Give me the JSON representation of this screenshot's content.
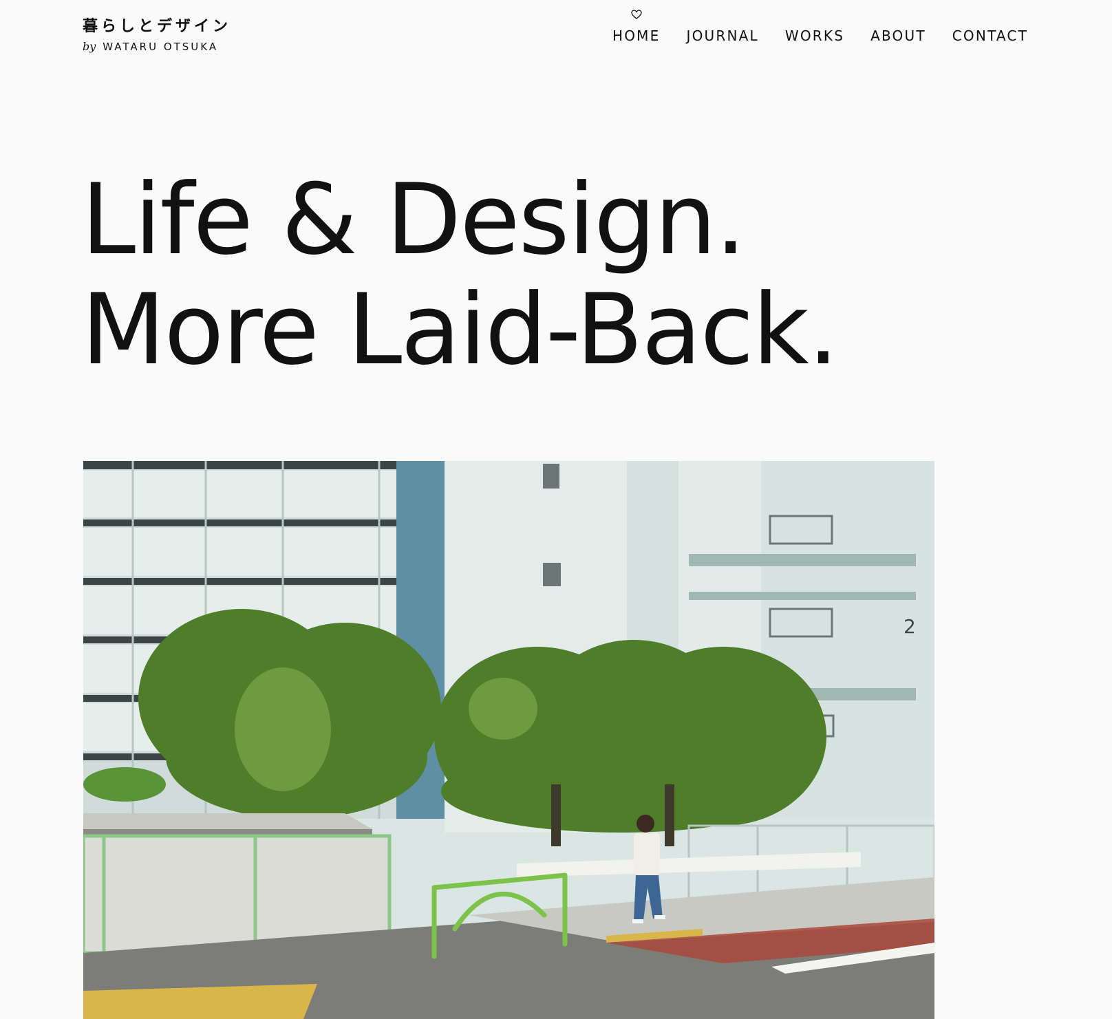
{
  "header": {
    "logo_title": "暮らしとデザイン",
    "logo_by": "by",
    "logo_author": "WATARU OTSUKA"
  },
  "nav": {
    "items": [
      {
        "label": "HOME",
        "active": true,
        "icon": "heart-icon"
      },
      {
        "label": "JOURNAL"
      },
      {
        "label": "WORKS"
      },
      {
        "label": "ABOUT"
      },
      {
        "label": "CONTACT"
      }
    ]
  },
  "hero": {
    "line1": "Life & Design.",
    "line2": "More Laid-Back."
  },
  "photo": {
    "subject": "photo",
    "building_number": "2"
  },
  "colors": {
    "background": "#fafafa",
    "text": "#111111",
    "building": "#dfe9e6",
    "foliage": "#4f7d2a",
    "fence": "#8cc68a",
    "rail": "#7dc24a"
  }
}
